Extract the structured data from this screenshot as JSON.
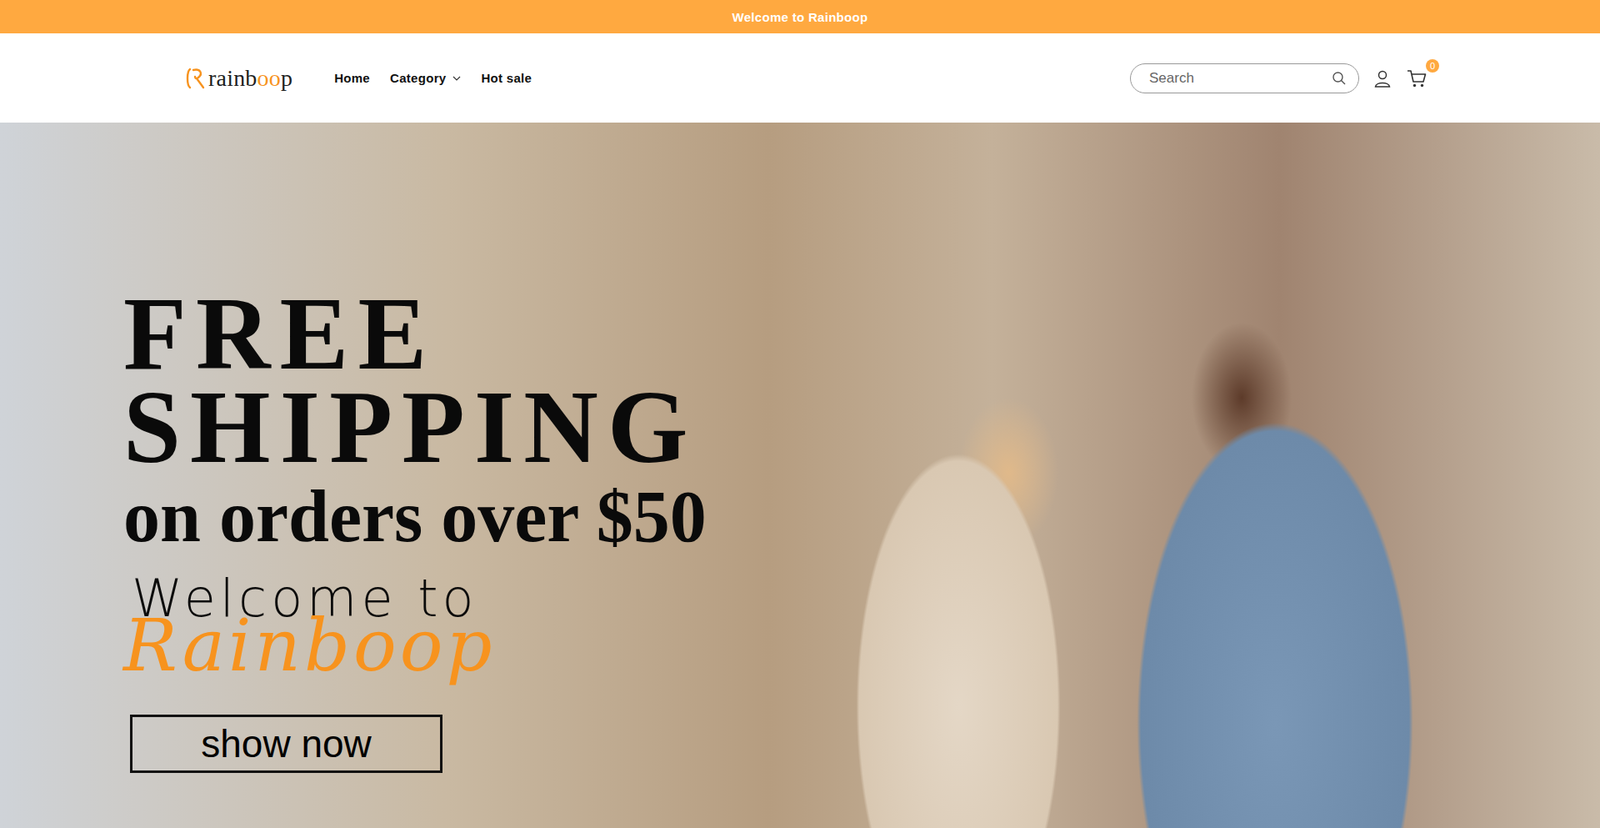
{
  "announcement": "Welcome to Rainboop",
  "logo": {
    "parts": [
      {
        "text": "rainb",
        "color": "#1f1f1f"
      },
      {
        "text": "oo",
        "color": "#f7931e"
      },
      {
        "text": "p",
        "color": "#1f1f1f"
      }
    ]
  },
  "nav": [
    {
      "label": "Home",
      "kind": "link"
    },
    {
      "label": "Category",
      "kind": "dropdown"
    },
    {
      "label": "Hot sale",
      "kind": "link"
    }
  ],
  "search": {
    "placeholder": "Search"
  },
  "cart": {
    "count": "0"
  },
  "hero": {
    "headline": [
      "FREE",
      "SHIPPING"
    ],
    "subline": "on orders over $50",
    "welcome": "Welcome to",
    "brand": "Rainboop",
    "button": "show now"
  }
}
